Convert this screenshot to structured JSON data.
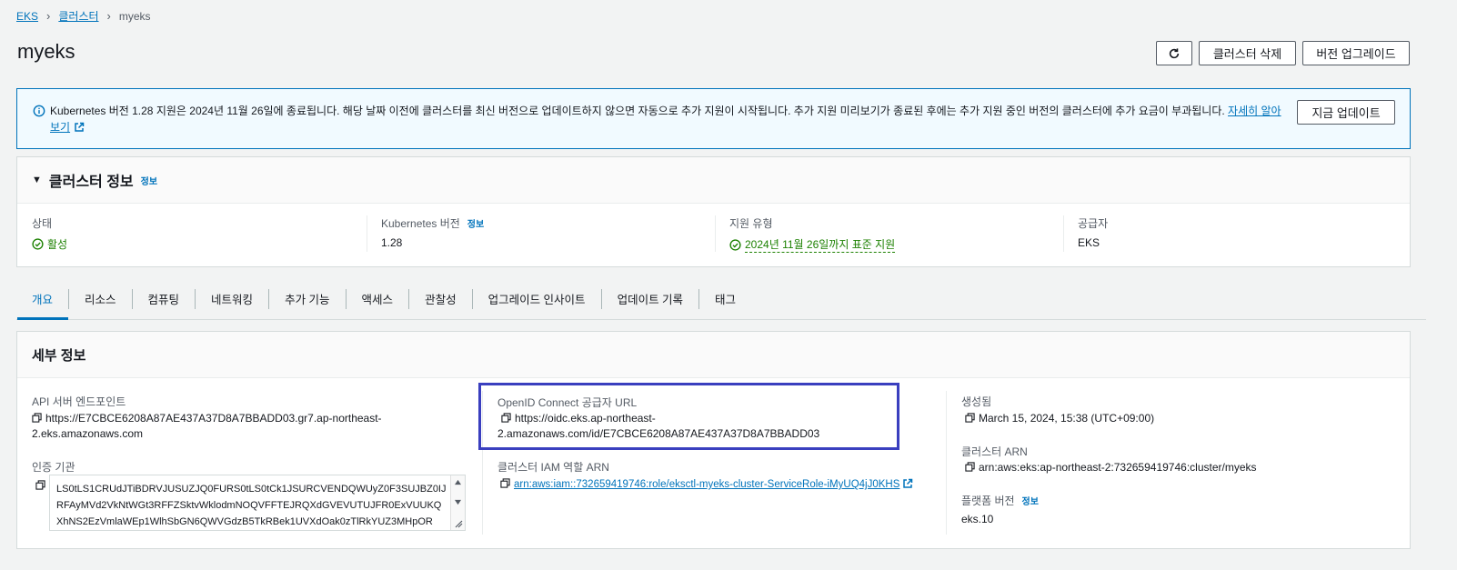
{
  "breadcrumb": {
    "eks": "EKS",
    "clusters": "클러스터",
    "current": "myeks"
  },
  "page": {
    "title": "myeks"
  },
  "header_buttons": {
    "delete": "클러스터 삭제",
    "upgrade": "버전 업그레이드"
  },
  "alert": {
    "text": "Kubernetes 버전 1.28 지원은 2024년 11월 26일에 종료됩니다. 해당 날짜 이전에 클러스터를 최신 버전으로 업데이트하지 않으면 자동으로 추가 지원이 시작됩니다. 추가 지원 미리보기가 종료된 후에는 추가 지원 중인 버전의 클러스터에 추가 요금이 부과됩니다.",
    "learn_more": "자세히 알아보기",
    "update_button": "지금 업데이트"
  },
  "cluster_info": {
    "title": "클러스터 정보",
    "info_link": "정보",
    "status_label": "상태",
    "status_value": "활성",
    "k8s_label": "Kubernetes 버전",
    "k8s_info": "정보",
    "k8s_value": "1.28",
    "support_label": "지원 유형",
    "support_value": "2024년 11월 26일까지 표준 지원",
    "provider_label": "공급자",
    "provider_value": "EKS"
  },
  "tabs": [
    "개요",
    "리소스",
    "컴퓨팅",
    "네트워킹",
    "추가 기능",
    "액세스",
    "관찰성",
    "업그레이드 인사이트",
    "업데이트 기록",
    "태그"
  ],
  "details": {
    "title": "세부 정보",
    "api_label": "API 서버 엔드포인트",
    "api_value_1": "https://E7CBCE6208A87AE437A37D8A7BBADD03.gr7.ap-northeast-",
    "api_value_2": "2.eks.amazonaws.com",
    "ca_label": "인증 기관",
    "ca_line_1": "LS0tLS1CRUdJTiBDRVJUSUZJQ0FURS0tLS0tCk1JSURCVENDQWUyZ0F3SUJBZ0IJ",
    "ca_line_2": "RFAyMVd2VkNtWGt3RFFZSktvWklodmNOQVFFTEJRQXdGVEVUTUJFR0ExVUUKQ",
    "ca_line_3": "XhNS2EzVmlaWEp1WlhSbGN6QWVGdzB5TkRBek1UVXdOak0zTlRkYUZ3MHpOR",
    "oidc_label": "OpenID Connect 공급자 URL",
    "oidc_value_1": "https://oidc.eks.ap-northeast-",
    "oidc_value_2": "2.amazonaws.com/id/E7CBCE6208A87AE437A37D8A7BBADD03",
    "role_label": "클러스터 IAM 역할 ARN",
    "role_value": "arn:aws:iam::732659419746:role/eksctl-myeks-cluster-ServiceRole-iMyUQ4jJ0KHS",
    "created_label": "생성됨",
    "created_value": "March 15, 2024, 15:38 (UTC+09:00)",
    "arn_label": "클러스터 ARN",
    "arn_value": "arn:aws:eks:ap-northeast-2:732659419746:cluster/myeks",
    "platform_label": "플랫폼 버전",
    "platform_info": "정보",
    "platform_value": "eks.10"
  },
  "colors": {
    "link": "#0073bb",
    "success": "#1d8102",
    "highlight": "#3a3fbf"
  }
}
